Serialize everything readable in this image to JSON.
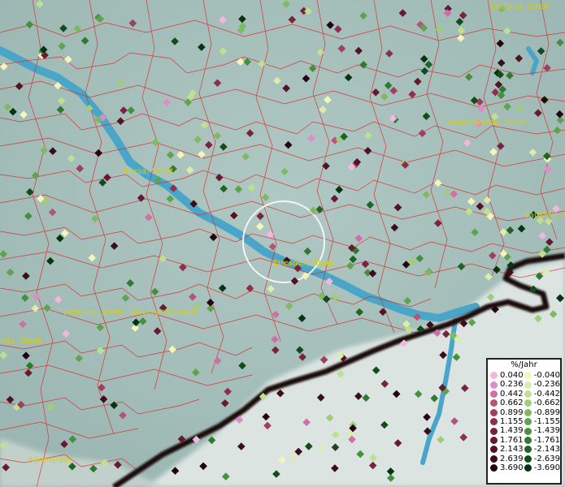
{
  "map": {
    "cities": [
      {
        "name": "Cottbus, Stadt"
      },
      {
        "name": "Hoyerswerda, Stadt"
      },
      {
        "name": "Riesa, Stadt"
      },
      {
        "name": "Bautzen, Stadt"
      },
      {
        "name": "Dresden, Stadt"
      },
      {
        "name": "Freiberg, Stadt, Universitätsstadt"
      },
      {
        "name": "nitz, Stadt"
      },
      {
        "name": "Bärenstein"
      }
    ],
    "colors": {
      "terrain": "#a9c2bf",
      "river": "#4aa6c8",
      "boundary": "#e02020",
      "border": "#111111"
    }
  },
  "legend": {
    "title": "%/Jahr",
    "positive": [
      {
        "label": "0.040",
        "color": "#f3b6e0"
      },
      {
        "label": "0.236",
        "color": "#e08cc8"
      },
      {
        "label": "0.442",
        "color": "#cf6fa8"
      },
      {
        "label": "0.662",
        "color": "#b7527f"
      },
      {
        "label": "0.899",
        "color": "#a13e60"
      },
      {
        "label": "1.155",
        "color": "#8e2f4b"
      },
      {
        "label": "1.439",
        "color": "#7a233c"
      },
      {
        "label": "1.761",
        "color": "#661a2f"
      },
      {
        "label": "2.143",
        "color": "#521324"
      },
      {
        "label": "2.639",
        "color": "#3b0c19"
      },
      {
        "label": "3.690",
        "color": "#220510"
      }
    ],
    "negative": [
      {
        "label": "-0.040",
        "color": "#f3f6b8"
      },
      {
        "label": "-0.236",
        "color": "#dcedaa"
      },
      {
        "label": "-0.442",
        "color": "#bfe090"
      },
      {
        "label": "-0.662",
        "color": "#9fcd78"
      },
      {
        "label": "-0.899",
        "color": "#7fba62"
      },
      {
        "label": "-1.155",
        "color": "#5ea44e"
      },
      {
        "label": "-1.439",
        "color": "#43903e"
      },
      {
        "label": "-1.761",
        "color": "#2f7a30"
      },
      {
        "label": "-2.143",
        "color": "#1f6326"
      },
      {
        "label": "-2.639",
        "color": "#124c1c"
      },
      {
        "label": "-3.690",
        "color": "#073410"
      }
    ]
  }
}
